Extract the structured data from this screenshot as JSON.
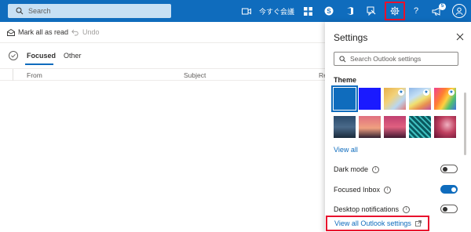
{
  "topbar": {
    "search_placeholder": "Search",
    "meet_now_label": "今すぐ会議",
    "notification_count": "5"
  },
  "commandbar": {
    "mark_all_read": "Mark all as read",
    "undo": "Undo"
  },
  "tabs": {
    "focused": "Focused",
    "other": "Other"
  },
  "columns": {
    "from": "From",
    "subject": "Subject",
    "received": "Re"
  },
  "settings": {
    "title": "Settings",
    "search_placeholder": "Search Outlook settings",
    "theme_label": "Theme",
    "view_all_themes": "View all",
    "dark_mode": "Dark mode",
    "focused_inbox": "Focused Inbox",
    "desktop_notifications": "Desktop notifications",
    "view_all_settings": "View all Outlook settings",
    "toggles": {
      "dark_mode": false,
      "focused_inbox": true,
      "desktop_notifications": false
    }
  },
  "colors": {
    "brand": "#0f6cbd",
    "highlight": "#e8112d"
  }
}
